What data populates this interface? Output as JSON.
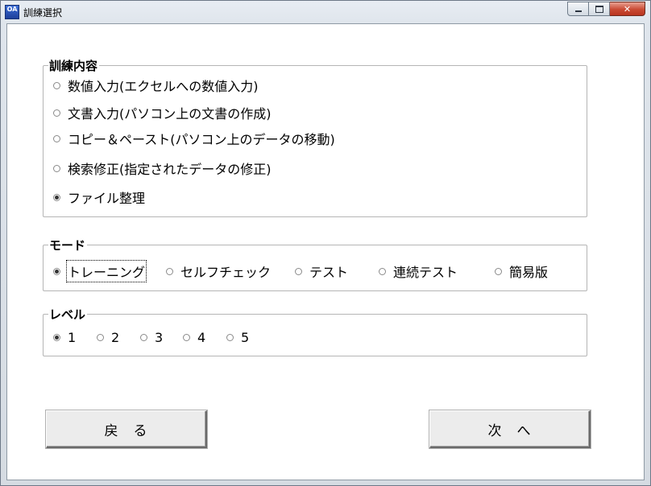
{
  "window": {
    "title": "訓練選択",
    "icon_label": "OA"
  },
  "training_group": {
    "legend": "訓練内容",
    "options": [
      {
        "label": "数値入力(エクセルへの数値入力)",
        "checked": false
      },
      {
        "label": "文書入力(パソコン上の文書の作成)",
        "checked": false
      },
      {
        "label": "コピー＆ペースト(パソコン上のデータの移動)",
        "checked": false
      },
      {
        "label": "検索修正(指定されたデータの修正)",
        "checked": false
      },
      {
        "label": "ファイル整理",
        "checked": true
      }
    ]
  },
  "mode_group": {
    "legend": "モード",
    "options": [
      {
        "label": "トレーニング",
        "checked": true
      },
      {
        "label": "セルフチェック",
        "checked": false
      },
      {
        "label": "テスト",
        "checked": false
      },
      {
        "label": "連続テスト",
        "checked": false
      },
      {
        "label": "簡易版",
        "checked": false
      }
    ]
  },
  "level_group": {
    "legend": "レベル",
    "options": [
      {
        "label": "1",
        "checked": true
      },
      {
        "label": "2",
        "checked": false
      },
      {
        "label": "3",
        "checked": false
      },
      {
        "label": "4",
        "checked": false
      },
      {
        "label": "5",
        "checked": false
      }
    ]
  },
  "buttons": {
    "back": "戻　る",
    "next": "次　へ"
  }
}
